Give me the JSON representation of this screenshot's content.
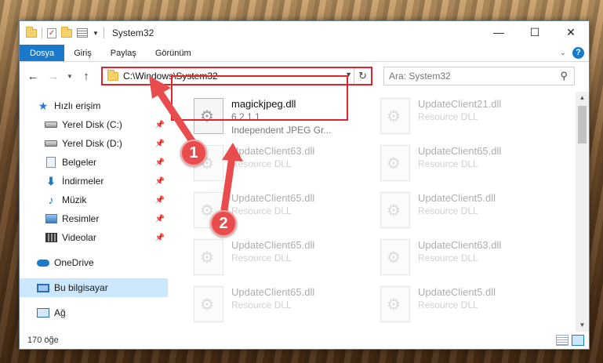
{
  "window": {
    "title": "System32",
    "minimize": "—",
    "maximize": "☐",
    "close": "✕"
  },
  "ribbon": {
    "tabs": [
      "Dosya",
      "Giriş",
      "Paylaş",
      "Görünüm"
    ],
    "help": "?"
  },
  "address": {
    "path": "C:\\Windows\\System32",
    "search_placeholder": "Ara: System32"
  },
  "nav": {
    "quick_access": "Hızlı erişim",
    "items": [
      {
        "label": "Yerel Disk (C:)",
        "icon": "drive-icon"
      },
      {
        "label": "Yerel Disk (D:)",
        "icon": "drive-icon"
      },
      {
        "label": "Belgeler",
        "icon": "documents-icon"
      },
      {
        "label": "İndirmeler",
        "icon": "download-icon"
      },
      {
        "label": "Müzik",
        "icon": "music-icon"
      },
      {
        "label": "Resimler",
        "icon": "pictures-icon"
      },
      {
        "label": "Videolar",
        "icon": "videos-icon"
      }
    ],
    "onedrive": "OneDrive",
    "this_pc": "Bu bilgisayar",
    "network": "Ağ"
  },
  "files": [
    {
      "name": "magickjpeg.dll",
      "line2": "6.2.1.1",
      "line3": "Independent JPEG Gr...",
      "highlight": true
    },
    {
      "name": "UpdateClient21.dll",
      "line2": "Resource DLL"
    },
    {
      "name": "UpdateClient63.dll",
      "line2": "Resource DLL"
    },
    {
      "name": "UpdateClient65.dll",
      "line2": "Resource DLL"
    },
    {
      "name": "UpdateClient65.dll",
      "line2": "Resource DLL"
    },
    {
      "name": "UpdateClient5.dll",
      "line2": "Resource DLL"
    },
    {
      "name": "UpdateClient65.dll",
      "line2": "Resource DLL"
    },
    {
      "name": "UpdateClient63.dll",
      "line2": "Resource DLL"
    },
    {
      "name": "UpdateClient65.dll",
      "line2": "Resource DLL"
    },
    {
      "name": "UpdateClient5.dll",
      "line2": "Resource DLL"
    }
  ],
  "status": {
    "count": "170 öğe"
  },
  "annotations": {
    "step1": "1",
    "step2": "2"
  },
  "colors": {
    "accent": "#1979ca",
    "highlight_red": "#e0242b",
    "badge_red": "#e84c4c"
  }
}
